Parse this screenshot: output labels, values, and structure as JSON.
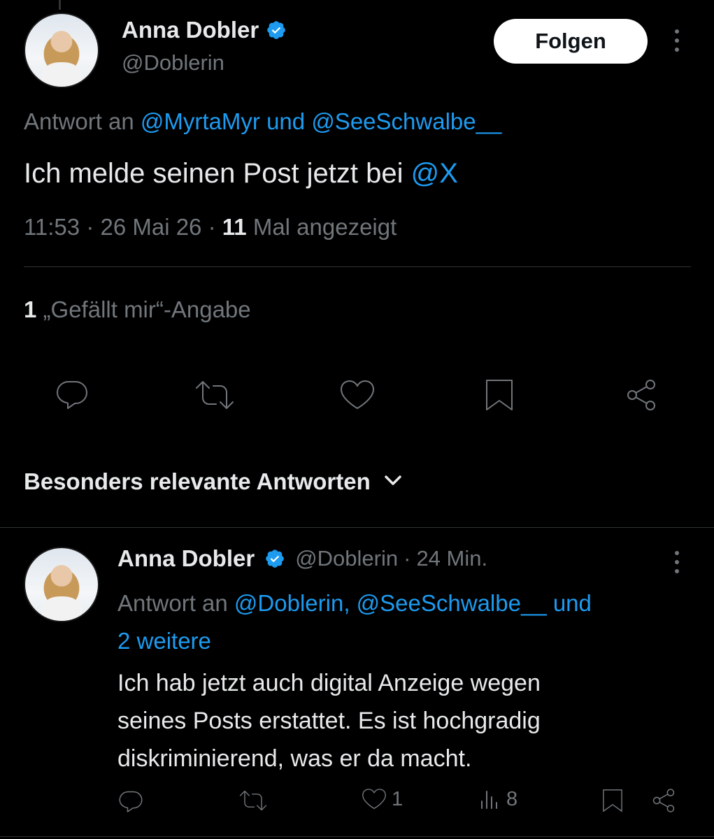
{
  "main_tweet": {
    "author_name": "Anna Dobler",
    "handle": "@Doblerin",
    "follow_label": "Folgen",
    "reply_prefix": "Antwort an",
    "reply_to_1": "@MyrtaMyr",
    "reply_conj": "und",
    "reply_to_2": "@SeeSchwalbe__",
    "text": "Ich melde seinen Post jetzt bei",
    "text_mention": "@X",
    "time": "11:53",
    "sep1": "·",
    "date": "26 Mai 26",
    "sep2": "·",
    "views_count": "11",
    "views_label": "Mal angezeigt",
    "likes_count": "1",
    "likes_label": "„Gefällt mir“-Angabe"
  },
  "replies_header": {
    "label": "Besonders relevante Antworten"
  },
  "reply": {
    "author_name": "Anna Dobler",
    "handle": "@Doblerin",
    "sep": "·",
    "time_ago": "24 Min.",
    "reply_prefix": "Antwort an",
    "reply_to": "@Doblerin, @SeeSchwalbe__ und",
    "reply_more": "2 weitere",
    "text_line1": "Ich hab jetzt auch digital Anzeige wegen",
    "text_line2": "seines Posts erstattet. Es ist hochgradig",
    "text_line3": "diskriminierend, was er da macht.",
    "like_count": "1",
    "view_count": "8"
  },
  "colors": {
    "background": "#000000",
    "text": "#e7e9ea",
    "secondary": "#71767b",
    "accent": "#1d9bf0",
    "divider": "#2f3336"
  },
  "icons": [
    "verified-badge-icon",
    "more-icon",
    "reply-icon",
    "retweet-icon",
    "like-icon",
    "bookmark-icon",
    "share-icon",
    "chevron-down-icon",
    "views-icon"
  ]
}
